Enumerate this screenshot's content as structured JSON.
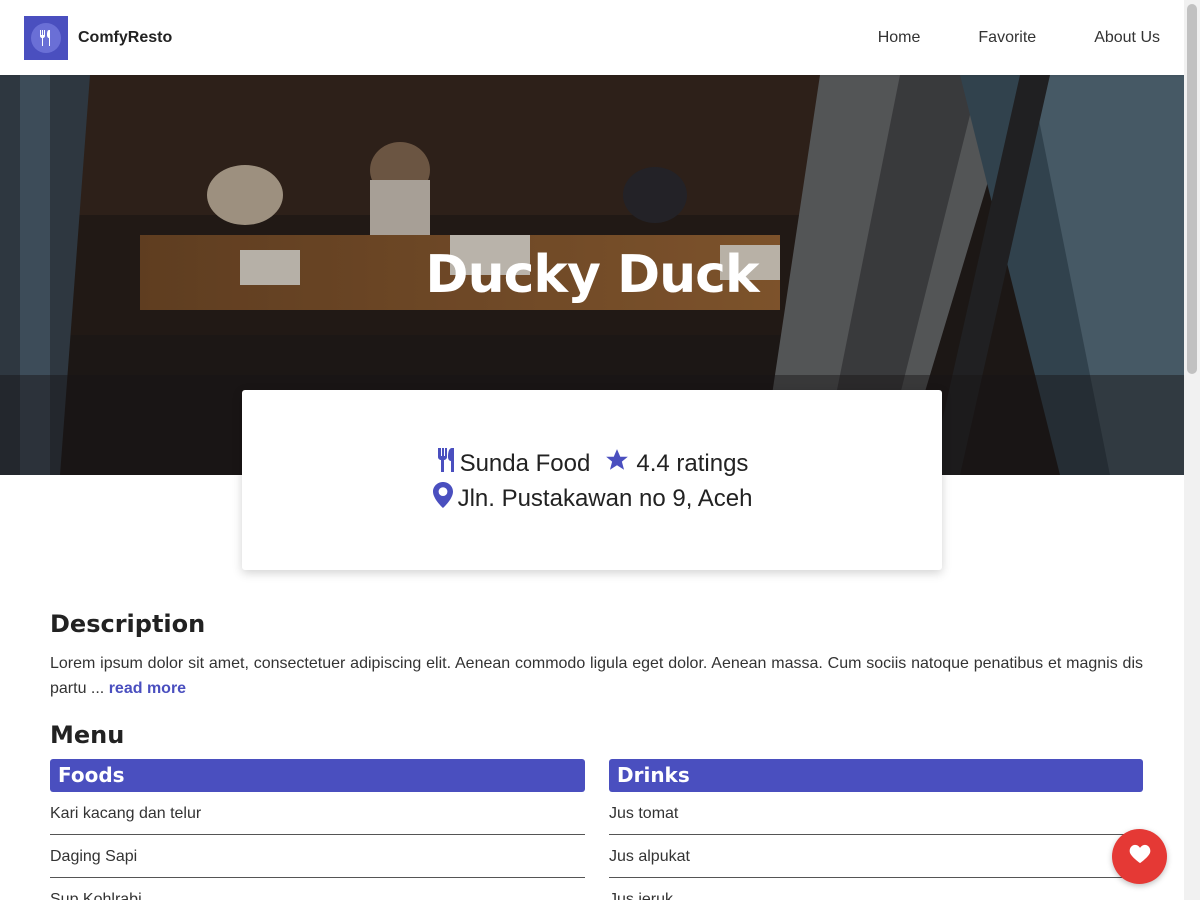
{
  "header": {
    "brand": "ComfyResto",
    "nav": [
      "Home",
      "Favorite",
      "About Us"
    ]
  },
  "hero": {
    "title": "Ducky Duck"
  },
  "info": {
    "category": "Sunda Food",
    "rating": "4.4 ratings",
    "address": "Jln. Pustakawan no 9, Aceh"
  },
  "description": {
    "title": "Description",
    "text": "Lorem ipsum dolor sit amet, consectetuer adipiscing elit. Aenean commodo ligula eget dolor. Aenean massa. Cum sociis natoque penatibus et magnis dis partu ...",
    "read_more": "read more"
  },
  "menu": {
    "title": "Menu",
    "foods": {
      "title": "Foods",
      "items": [
        "Kari kacang dan telur",
        "Daging Sapi",
        "Sup Kohlrabi"
      ]
    },
    "drinks": {
      "title": "Drinks",
      "items": [
        "Jus tomat",
        "Jus alpukat",
        "Jus jeruk"
      ]
    }
  },
  "colors": {
    "accent": "#4a4fbf",
    "favorite": "#e53935"
  },
  "icons": {
    "logo": "fork-knife-icon",
    "category": "utensils-icon",
    "rating": "star-icon",
    "address": "map-pin-icon",
    "favorite": "heart-icon"
  }
}
